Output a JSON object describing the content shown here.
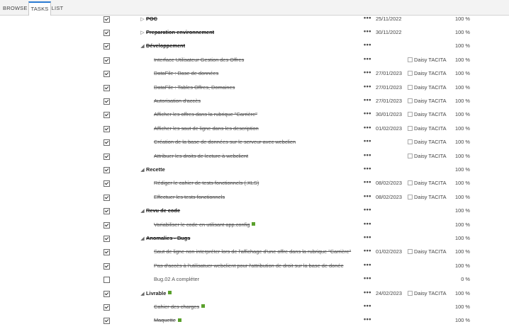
{
  "tabs": [
    {
      "label": "BROWSE"
    },
    {
      "label": "TASKS"
    },
    {
      "label": "LIST"
    }
  ],
  "more_label": "•••",
  "rows": [
    {
      "title": "POC",
      "level": 0,
      "expander": "collapsed",
      "summary": true,
      "checked": true,
      "done": true,
      "date": "25/11/2022",
      "assignee": "",
      "percent": "100 %",
      "note": false
    },
    {
      "title": "Preparation environnement",
      "level": 0,
      "expander": "collapsed",
      "summary": true,
      "checked": true,
      "done": true,
      "date": "30/11/2022",
      "assignee": "",
      "percent": "100 %",
      "note": false
    },
    {
      "title": "Développement",
      "level": 0,
      "expander": "expanded",
      "summary": true,
      "checked": true,
      "done": true,
      "date": "",
      "assignee": "",
      "percent": "100 %",
      "note": false
    },
    {
      "title": "Interface Utilisateur Gestion des Offres",
      "level": 1,
      "expander": "",
      "summary": false,
      "checked": true,
      "done": true,
      "date": "",
      "assignee": "Daisy TACITA",
      "percent": "100 %",
      "note": false
    },
    {
      "title": "DataFile : Base de données",
      "level": 1,
      "expander": "",
      "summary": false,
      "checked": true,
      "done": true,
      "date": "27/01/2023",
      "assignee": "Daisy TACITA",
      "percent": "100 %",
      "note": false
    },
    {
      "title": "DataFile : Tables Offres, Domaines",
      "level": 1,
      "expander": "",
      "summary": false,
      "checked": true,
      "done": true,
      "date": "27/01/2023",
      "assignee": "Daisy TACITA",
      "percent": "100 %",
      "note": false
    },
    {
      "title": "Autorisation d'accès",
      "level": 1,
      "expander": "",
      "summary": false,
      "checked": true,
      "done": true,
      "date": "27/01/2023",
      "assignee": "Daisy TACITA",
      "percent": "100 %",
      "note": false
    },
    {
      "title": "Afficher les offres dans la rubrique \"Carrière\"",
      "level": 1,
      "expander": "",
      "summary": false,
      "checked": true,
      "done": true,
      "date": "30/01/2023",
      "assignee": "Daisy TACITA",
      "percent": "100 %",
      "note": false
    },
    {
      "title": "Afficher les saut de ligne dans les description",
      "level": 1,
      "expander": "",
      "summary": false,
      "checked": true,
      "done": true,
      "date": "01/02/2023",
      "assignee": "Daisy TACITA",
      "percent": "100 %",
      "note": false
    },
    {
      "title": "Création de la base de données sur le serveur avec webclien",
      "level": 1,
      "expander": "",
      "summary": false,
      "checked": true,
      "done": true,
      "date": "",
      "assignee": "Daisy TACITA",
      "percent": "100 %",
      "note": false
    },
    {
      "title": "Attribuer les droits de lecture à webclient",
      "level": 1,
      "expander": "",
      "summary": false,
      "checked": true,
      "done": true,
      "date": "",
      "assignee": "Daisy TACITA",
      "percent": "100 %",
      "note": false
    },
    {
      "title": "Recette",
      "level": 0,
      "expander": "expanded",
      "summary": true,
      "checked": true,
      "done": false,
      "date": "",
      "assignee": "",
      "percent": "100 %",
      "note": false
    },
    {
      "title": "Rédiger le cahier de tests fonctionnels (.XLS)",
      "level": 1,
      "expander": "",
      "summary": false,
      "checked": true,
      "done": true,
      "date": "08/02/2023",
      "assignee": "Daisy TACITA",
      "percent": "100 %",
      "note": false
    },
    {
      "title": "Effectuer les tests fonctionnels",
      "level": 1,
      "expander": "",
      "summary": false,
      "checked": true,
      "done": true,
      "date": "08/02/2023",
      "assignee": "Daisy TACITA",
      "percent": "100 %",
      "note": false
    },
    {
      "title": "Revu de code",
      "level": 0,
      "expander": "expanded",
      "summary": true,
      "checked": true,
      "done": true,
      "date": "",
      "assignee": "",
      "percent": "100 %",
      "note": false
    },
    {
      "title": "Variabiliser le code en utilisant app.config",
      "level": 1,
      "expander": "",
      "summary": false,
      "checked": true,
      "done": true,
      "date": "",
      "assignee": "",
      "percent": "100 %",
      "note": true
    },
    {
      "title": "Anomalies - Bugs",
      "level": 0,
      "expander": "expanded",
      "summary": true,
      "checked": true,
      "done": true,
      "date": "",
      "assignee": "",
      "percent": "100 %",
      "note": false
    },
    {
      "title": "Saut de ligne non interpréter lors de l'affichage d'une offre dans la rubrique \"Carrière\"",
      "level": 1,
      "expander": "",
      "summary": false,
      "checked": true,
      "done": true,
      "date": "01/02/2023",
      "assignee": "Daisy TACITA",
      "percent": "100 %",
      "note": false
    },
    {
      "title": "Pas d'accès à l'utilisatuer webclient pour l'attribution de droit sur la base de donée",
      "level": 1,
      "expander": "",
      "summary": false,
      "checked": true,
      "done": true,
      "date": "",
      "assignee": "",
      "percent": "100 %",
      "note": false
    },
    {
      "title": "Bug.02 A compléter",
      "level": 1,
      "expander": "",
      "summary": false,
      "checked": false,
      "done": false,
      "date": "",
      "assignee": "",
      "percent": "0 %",
      "note": false
    },
    {
      "title": "Livrable",
      "level": 0,
      "expander": "expanded",
      "summary": true,
      "checked": true,
      "done": false,
      "date": "24/02/2023",
      "assignee": "Daisy TACITA",
      "percent": "100 %",
      "note": true
    },
    {
      "title": "Cahier des charges",
      "level": 1,
      "expander": "",
      "summary": false,
      "checked": true,
      "done": true,
      "date": "",
      "assignee": "",
      "percent": "100 %",
      "note": true
    },
    {
      "title": "Maquette",
      "level": 1,
      "expander": "",
      "summary": false,
      "checked": true,
      "done": true,
      "date": "",
      "assignee": "",
      "percent": "100 %",
      "note": true
    }
  ]
}
